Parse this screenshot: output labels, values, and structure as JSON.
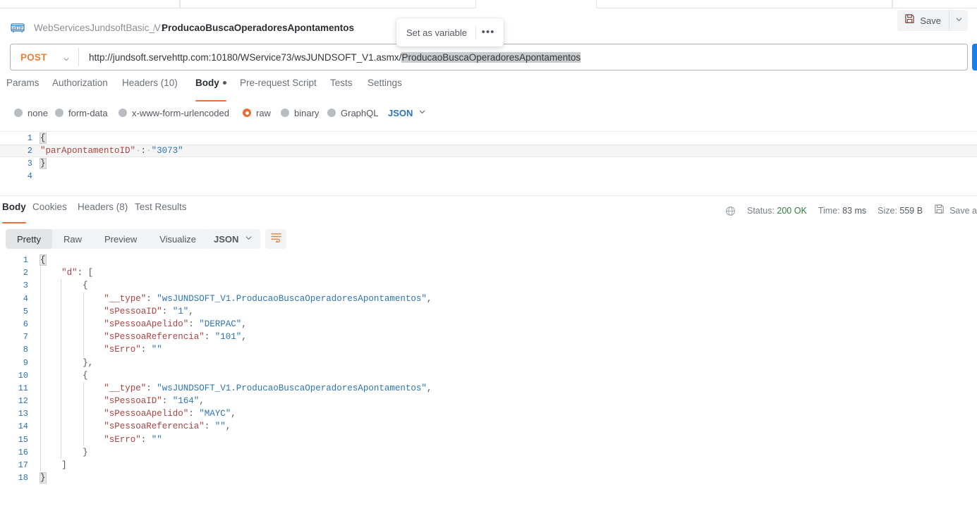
{
  "app": "Postman",
  "breadcrumb": {
    "icon": "http-badge-icon",
    "collection": "WebServicesJundsoftBasic_V1",
    "separator": "/",
    "request": "ProducaoBuscaOperadoresApontamentos"
  },
  "popover": {
    "set_as_variable": "Set as variable",
    "more": "•••"
  },
  "toolbar": {
    "save_label": "Save"
  },
  "url_bar": {
    "method": "POST",
    "url_prefix": "http://jundsoft.servehttp.com:10180/WService73/wsJUNDSOFT_V1.asmx/",
    "url_selected": "ProducaoBuscaOperadoresApontamentos",
    "full_url": "http://jundsoft.servehttp.com:10180/WService73/wsJUNDSOFT_V1.asmx/ProducaoBuscaOperadoresApontamentos"
  },
  "request_tabs": [
    {
      "label": "Params",
      "active": false
    },
    {
      "label": "Authorization",
      "active": false
    },
    {
      "label": "Headers (10)",
      "active": false
    },
    {
      "label": "Body",
      "active": true,
      "dot": true
    },
    {
      "label": "Pre-request Script",
      "active": false
    },
    {
      "label": "Tests",
      "active": false
    },
    {
      "label": "Settings",
      "active": false
    }
  ],
  "body_types": [
    {
      "label": "none",
      "selected": false
    },
    {
      "label": "form-data",
      "selected": false
    },
    {
      "label": "x-www-form-urlencoded",
      "selected": false
    },
    {
      "label": "raw",
      "selected": true
    },
    {
      "label": "binary",
      "selected": false
    },
    {
      "label": "GraphQL",
      "selected": false
    }
  ],
  "body_format": {
    "label": "JSON",
    "chevron": "chevron-down-icon"
  },
  "request_body": {
    "lines": [
      {
        "n": "1",
        "highlight": false,
        "tokens": [
          {
            "t": "{",
            "c": "brk"
          }
        ]
      },
      {
        "n": "2",
        "highlight": true,
        "tokens": [
          {
            "t": "\"parApontamentoID\"",
            "c": "k"
          },
          {
            "t": "·",
            "c": "dot"
          },
          {
            "t": ":",
            "c": "p"
          },
          {
            "t": "·",
            "c": "dot"
          },
          {
            "t": "\"3073\"",
            "c": "v"
          }
        ]
      },
      {
        "n": "3",
        "highlight": false,
        "tokens": [
          {
            "t": "}",
            "c": "brk"
          }
        ]
      },
      {
        "n": "4",
        "highlight": false,
        "tokens": []
      }
    ]
  },
  "response_tabs": [
    {
      "label": "Body",
      "active": true
    },
    {
      "label": "Cookies",
      "active": false
    },
    {
      "label": "Headers (8)",
      "active": false
    },
    {
      "label": "Test Results",
      "active": false
    }
  ],
  "response_status": {
    "globe_icon": "globe-icon",
    "status_label": "Status:",
    "status_value": "200 OK",
    "time_label": "Time:",
    "time_value": "83 ms",
    "size_label": "Size:",
    "size_value": "559 B",
    "save_icon": "floppy-disk-icon",
    "save_response": "Save a"
  },
  "response_view": {
    "modes": [
      {
        "label": "Pretty",
        "active": true
      },
      {
        "label": "Raw",
        "active": false
      },
      {
        "label": "Preview",
        "active": false
      },
      {
        "label": "Visualize",
        "active": false
      }
    ],
    "format": "JSON",
    "wrap_icon": "wrap-text-icon"
  },
  "response_body": {
    "lines": [
      {
        "n": "1",
        "indent": 0,
        "guides": 0,
        "tokens": [
          {
            "t": "{",
            "c": "brk"
          }
        ]
      },
      {
        "n": "2",
        "indent": 4,
        "guides": 1,
        "tokens": [
          {
            "t": "\"d\"",
            "c": "k"
          },
          {
            "t": ": [",
            "c": "p"
          }
        ]
      },
      {
        "n": "3",
        "indent": 8,
        "guides": 2,
        "tokens": [
          {
            "t": "{",
            "c": "p"
          }
        ]
      },
      {
        "n": "4",
        "indent": 12,
        "guides": 3,
        "tokens": [
          {
            "t": "\"__type\"",
            "c": "k"
          },
          {
            "t": ": ",
            "c": "p"
          },
          {
            "t": "\"wsJUNDSOFT_V1.ProducaoBuscaOperadoresApontamentos\"",
            "c": "v"
          },
          {
            "t": ",",
            "c": "p"
          }
        ]
      },
      {
        "n": "5",
        "indent": 12,
        "guides": 3,
        "tokens": [
          {
            "t": "\"sPessoaID\"",
            "c": "k"
          },
          {
            "t": ": ",
            "c": "p"
          },
          {
            "t": "\"1\"",
            "c": "v"
          },
          {
            "t": ",",
            "c": "p"
          }
        ]
      },
      {
        "n": "6",
        "indent": 12,
        "guides": 3,
        "tokens": [
          {
            "t": "\"sPessoaApelido\"",
            "c": "k"
          },
          {
            "t": ": ",
            "c": "p"
          },
          {
            "t": "\"DERPAC\"",
            "c": "v"
          },
          {
            "t": ",",
            "c": "p"
          }
        ]
      },
      {
        "n": "7",
        "indent": 12,
        "guides": 3,
        "tokens": [
          {
            "t": "\"sPessoaReferencia\"",
            "c": "k"
          },
          {
            "t": ": ",
            "c": "p"
          },
          {
            "t": "\"101\"",
            "c": "v"
          },
          {
            "t": ",",
            "c": "p"
          }
        ]
      },
      {
        "n": "8",
        "indent": 12,
        "guides": 3,
        "tokens": [
          {
            "t": "\"sErro\"",
            "c": "k"
          },
          {
            "t": ": ",
            "c": "p"
          },
          {
            "t": "\"\"",
            "c": "v"
          }
        ]
      },
      {
        "n": "9",
        "indent": 8,
        "guides": 2,
        "tokens": [
          {
            "t": "},",
            "c": "p"
          }
        ]
      },
      {
        "n": "10",
        "indent": 8,
        "guides": 2,
        "tokens": [
          {
            "t": "{",
            "c": "p"
          }
        ]
      },
      {
        "n": "11",
        "indent": 12,
        "guides": 3,
        "tokens": [
          {
            "t": "\"__type\"",
            "c": "k"
          },
          {
            "t": ": ",
            "c": "p"
          },
          {
            "t": "\"wsJUNDSOFT_V1.ProducaoBuscaOperadoresApontamentos\"",
            "c": "v"
          },
          {
            "t": ",",
            "c": "p"
          }
        ]
      },
      {
        "n": "12",
        "indent": 12,
        "guides": 3,
        "tokens": [
          {
            "t": "\"sPessoaID\"",
            "c": "k"
          },
          {
            "t": ": ",
            "c": "p"
          },
          {
            "t": "\"164\"",
            "c": "v"
          },
          {
            "t": ",",
            "c": "p"
          }
        ]
      },
      {
        "n": "13",
        "indent": 12,
        "guides": 3,
        "tokens": [
          {
            "t": "\"sPessoaApelido\"",
            "c": "k"
          },
          {
            "t": ": ",
            "c": "p"
          },
          {
            "t": "\"MAYC\"",
            "c": "v"
          },
          {
            "t": ",",
            "c": "p"
          }
        ]
      },
      {
        "n": "14",
        "indent": 12,
        "guides": 3,
        "tokens": [
          {
            "t": "\"sPessoaReferencia\"",
            "c": "k"
          },
          {
            "t": ": ",
            "c": "p"
          },
          {
            "t": "\"\"",
            "c": "v"
          },
          {
            "t": ",",
            "c": "p"
          }
        ]
      },
      {
        "n": "15",
        "indent": 12,
        "guides": 3,
        "tokens": [
          {
            "t": "\"sErro\"",
            "c": "k"
          },
          {
            "t": ": ",
            "c": "p"
          },
          {
            "t": "\"\"",
            "c": "v"
          }
        ]
      },
      {
        "n": "16",
        "indent": 8,
        "guides": 2,
        "tokens": [
          {
            "t": "}",
            "c": "p"
          }
        ]
      },
      {
        "n": "17",
        "indent": 4,
        "guides": 1,
        "tokens": [
          {
            "t": "]",
            "c": "p"
          }
        ]
      },
      {
        "n": "18",
        "indent": 0,
        "guides": 0,
        "tokens": [
          {
            "t": "}",
            "c": "brk"
          }
        ]
      }
    ]
  },
  "colors": {
    "accent_orange": "#ef6c33",
    "send_blue": "#1a7ee8",
    "json_key": "#a94442",
    "json_value": "#2e74b5",
    "status_ok": "#2f7d3b"
  }
}
